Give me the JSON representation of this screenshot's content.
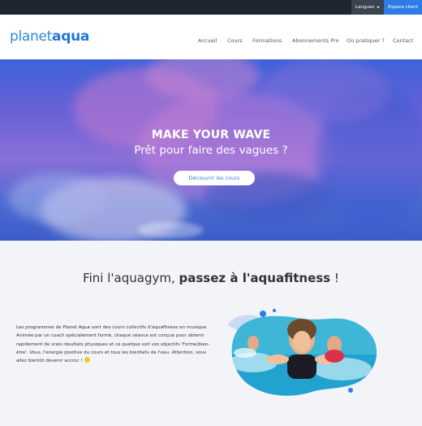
{
  "topbar": {
    "languages_label": "Langues",
    "client_label": "Espace client"
  },
  "header": {
    "logo": {
      "part1": "planet",
      "part2": "aqua"
    },
    "nav": [
      {
        "label": "Accueil"
      },
      {
        "label": "Cours"
      },
      {
        "label": "Formations"
      },
      {
        "label": "Abonnements Pro"
      },
      {
        "label": "Où pratiquer ?"
      },
      {
        "label": "Contact"
      }
    ]
  },
  "hero": {
    "title": "MAKE YOUR WAVE",
    "subtitle": "Prêt pour faire des vagues ?",
    "cta_label": "Découvrir les cours"
  },
  "intro": {
    "title_plain": "Fini l'aquagym,",
    "title_bold": "passez à l'aquafitness",
    "title_end": "!",
    "paragraph": "Les programmes de Planet Aqua sont des cours collectifs d'aquafitness en musique. Animée par un coach spécialement formé, chaque séance est conçue pour obtenir rapidement de vrais résultats physiques et ce quelque soit vos objectifs 'Forme/bien-être'. Vous, l'energie positive du cours et tous les bienfaits de l'eau. Attention, vous allez bientôt devenir accroc !"
  },
  "colors": {
    "brand": "#2e7de6",
    "topbar": "#1f2630",
    "hero": "#5b63d6"
  },
  "icons": {
    "lang_caret": "chevron-down-icon",
    "smiley": "smiley-icon"
  }
}
